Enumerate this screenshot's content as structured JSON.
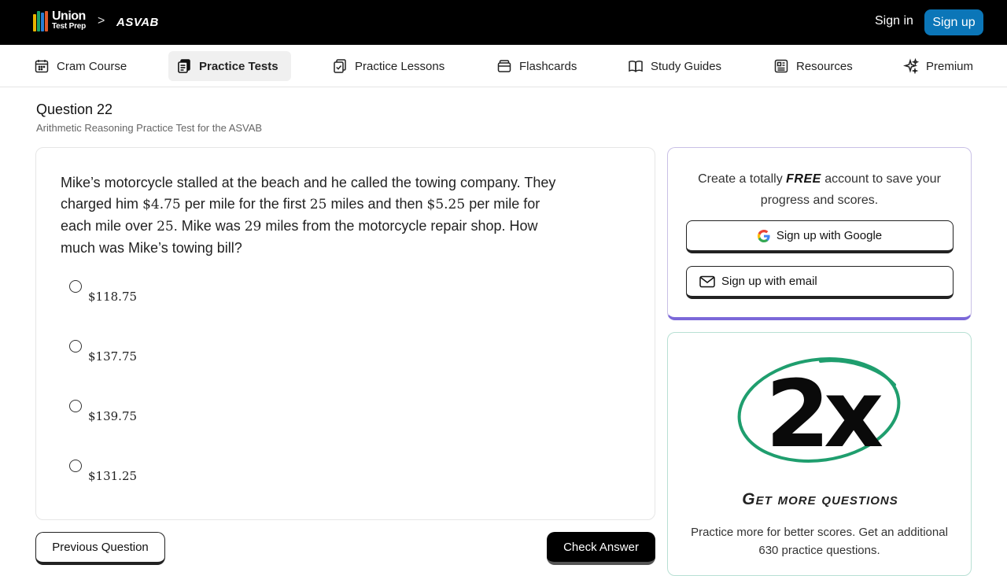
{
  "header": {
    "brand_line1": "Union",
    "brand_line2": "Test Prep",
    "separator": ">",
    "section": "ASVAB",
    "sign_in": "Sign in",
    "sign_up": "Sign up"
  },
  "nav": {
    "items": [
      {
        "label": "Cram Course",
        "icon": "calendar-icon"
      },
      {
        "label": "Practice Tests",
        "icon": "document-stack-icon",
        "active": true
      },
      {
        "label": "Practice Lessons",
        "icon": "clipboard-check-icon"
      },
      {
        "label": "Flashcards",
        "icon": "cards-icon"
      },
      {
        "label": "Study Guides",
        "icon": "book-open-icon"
      },
      {
        "label": "Resources",
        "icon": "newspaper-icon"
      },
      {
        "label": "Premium",
        "icon": "sparkle-icon"
      }
    ]
  },
  "question": {
    "title": "Question 22",
    "subtitle": "Arithmetic Reasoning Practice Test for the ASVAB",
    "text_parts": {
      "p1": "Mike’s motorcycle stalled at the beach and he called the towing company. They charged him ",
      "n1": "$4.75",
      "p2": " per mile for the first ",
      "n2": "25",
      "p3": " miles and then ",
      "n3": "$5.25",
      "p4": " per mile for each mile over ",
      "n4": "25",
      "p5": ". Mike was ",
      "n5": "29",
      "p6": " miles from the motorcycle repair shop. How much was Mike’s towing bill?"
    },
    "options": [
      "$118.75",
      "$137.75",
      "$139.75",
      "$131.25"
    ]
  },
  "actions": {
    "previous": "Previous Question",
    "check": "Check Answer"
  },
  "signup_card": {
    "msg_before": "Create a totally ",
    "msg_free": "FREE",
    "msg_after": " account to save your progress and scores.",
    "google_label": "Sign up with Google",
    "email_label": "Sign up with email"
  },
  "promo": {
    "art_text": "2x",
    "heading": "Get more questions",
    "text": "Practice more for better scores. Get an additional 630 practice questions."
  },
  "colors": {
    "topbar_bg": "#000000",
    "signup_btn": "#0b76b8",
    "signup_card_accent": "#7b68d9",
    "promo_circle": "#1f9e6e"
  }
}
